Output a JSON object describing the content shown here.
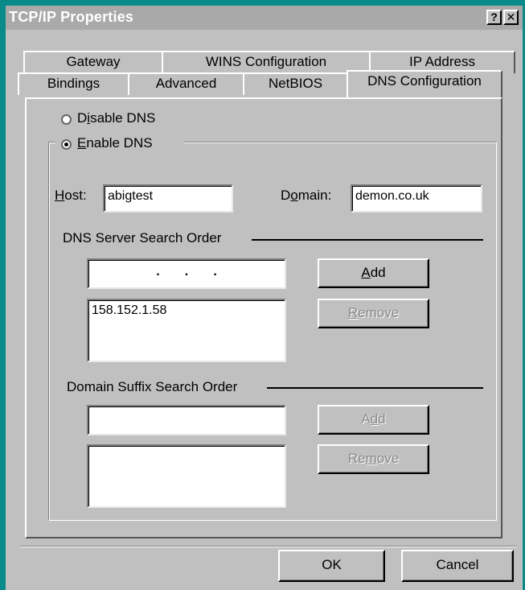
{
  "window": {
    "title": "TCP/IP Properties",
    "help_label": "?",
    "close_label": "✕"
  },
  "tabs": {
    "back": [
      "Gateway",
      "WINS Configuration",
      "IP Address"
    ],
    "front": [
      "Bindings",
      "Advanced",
      "NetBIOS",
      "DNS Configuration"
    ],
    "active": "DNS Configuration"
  },
  "dns": {
    "disable": {
      "pre": "D",
      "key": "i",
      "post": "sable DNS",
      "selected": false
    },
    "enable": {
      "pre": "",
      "key": "E",
      "post": "nable DNS",
      "selected": true
    },
    "host": {
      "key": "H",
      "post": "ost:",
      "value": "abigtest"
    },
    "domain": {
      "pre": "D",
      "key": "o",
      "post": "main:",
      "value": "demon.co.uk"
    },
    "server_order": {
      "label": "DNS Server Search Order",
      "ip_input": ".       .       .",
      "entries": [
        "158.152.1.58"
      ],
      "add": {
        "key": "A",
        "post": "dd"
      },
      "remove": {
        "key": "R",
        "post": "emove"
      }
    },
    "suffix_order": {
      "label": "Domain Suffix Search Order",
      "input": "",
      "entries": [],
      "add": {
        "pre": "A",
        "key": "d",
        "post": "d"
      },
      "remove": {
        "pre": "Re",
        "key": "m",
        "post": "ove"
      }
    }
  },
  "footer": {
    "ok": "OK",
    "cancel": "Cancel"
  },
  "colors": {
    "frame": "#0a8a8a",
    "titlebar": "#a9a9a9",
    "face": "#c0c0c0"
  }
}
